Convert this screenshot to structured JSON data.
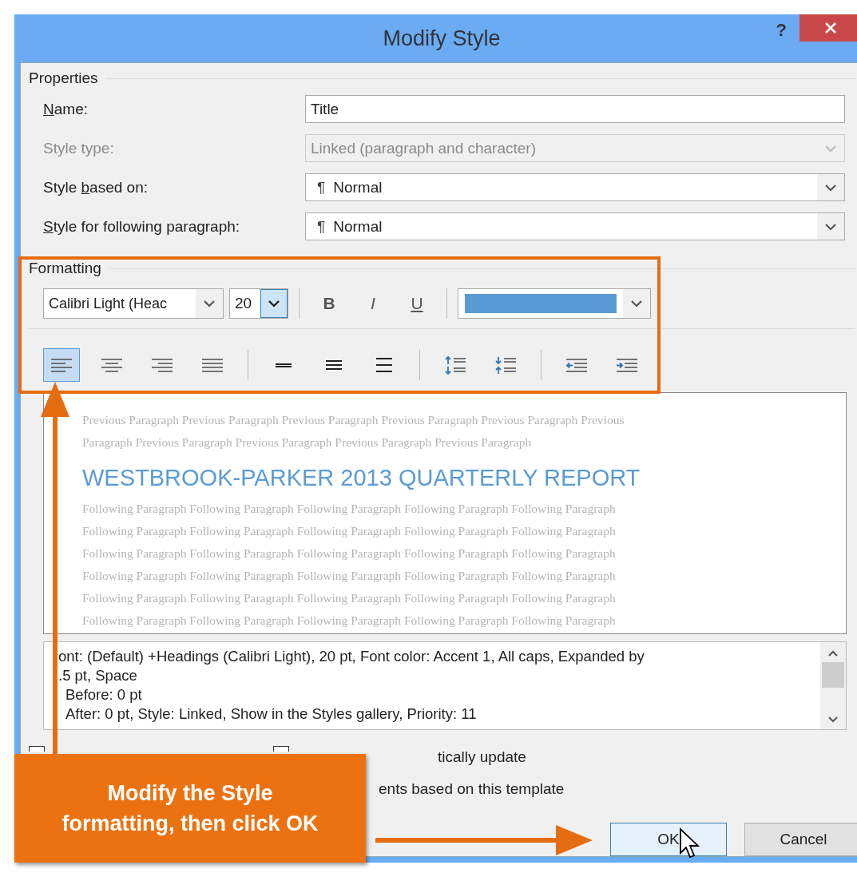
{
  "window": {
    "title": "Modify Style",
    "help": "?"
  },
  "properties": {
    "heading": "Properties",
    "fields": [
      {
        "kind": "text",
        "label": {
          "key": "N",
          "after": "ame:"
        },
        "disabled": false,
        "value": "Title"
      },
      {
        "kind": "dropdown",
        "label": {
          "before": "Style type:"
        },
        "disabled": true,
        "value": "Linked (paragraph and character)"
      },
      {
        "kind": "dropdown",
        "label": {
          "before": "Style ",
          "key": "b",
          "after": "ased on:"
        },
        "disabled": false,
        "mark": "¶",
        "value": "Normal"
      },
      {
        "kind": "dropdown",
        "label": {
          "key": "S",
          "after": "tyle for following paragraph:"
        },
        "disabled": false,
        "mark": "¶",
        "value": "Normal"
      }
    ]
  },
  "formatting": {
    "heading": "Formatting",
    "font": "Calibri Light (Heac",
    "size": "20",
    "styles": [
      "B",
      "I",
      "U"
    ],
    "color": "#5b9bd5",
    "paragraph_groups": [
      [
        {
          "kind": "align-left",
          "selected": true
        },
        {
          "kind": "align-center",
          "selected": false
        },
        {
          "kind": "align-right",
          "selected": false
        },
        {
          "kind": "justify",
          "selected": false
        }
      ],
      [
        {
          "kind": "single-spacing",
          "selected": false
        },
        {
          "kind": "one-half-spacing",
          "selected": false
        },
        {
          "kind": "double-spacing",
          "selected": false
        }
      ],
      [
        {
          "kind": "increase-spacing",
          "selected": false
        },
        {
          "kind": "decrease-spacing",
          "selected": false
        }
      ],
      [
        {
          "kind": "decrease-indent",
          "selected": false
        },
        {
          "kind": "increase-indent",
          "selected": false
        }
      ]
    ]
  },
  "preview": {
    "previous": [
      "Previous Paragraph Previous Paragraph Previous Paragraph Previous Paragraph Previous Paragraph Previous",
      "Paragraph Previous Paragraph Previous Paragraph Previous Paragraph Previous Paragraph"
    ],
    "title": "WESTBROOK-PARKER 2013 QUARTERLY REPORT",
    "following": [
      "Following Paragraph Following Paragraph Following Paragraph Following Paragraph Following Paragraph",
      "Following Paragraph Following Paragraph Following Paragraph Following Paragraph Following Paragraph",
      "Following Paragraph Following Paragraph Following Paragraph Following Paragraph Following Paragraph",
      "Following Paragraph Following Paragraph Following Paragraph Following Paragraph Following Paragraph",
      "Following Paragraph Following Paragraph Following Paragraph Following Paragraph Following Paragraph",
      "Following Paragraph Following Paragraph Following Paragraph Following Paragraph Following Paragraph"
    ]
  },
  "description": [
    "ont: (Default) +Headings (Calibri Light), 20 pt, Font color: Accent 1, All caps, Expanded by",
    ".5 pt, Space",
    "Before:  0 pt",
    "After:  0 pt, Style: Linked, Show in the Styles gallery, Priority: 11"
  ],
  "checkboxes": [
    {
      "checked": false
    },
    {
      "checked": false
    }
  ],
  "options": [
    {
      "label": "tically update"
    },
    {
      "label": "ents based on this template"
    }
  ],
  "buttons": [
    {
      "label": "OK",
      "focused": true
    },
    {
      "label": "Cancel",
      "focused": false
    }
  ],
  "callout": {
    "text": [
      "Modify the Style",
      "formatting, then click OK"
    ]
  }
}
